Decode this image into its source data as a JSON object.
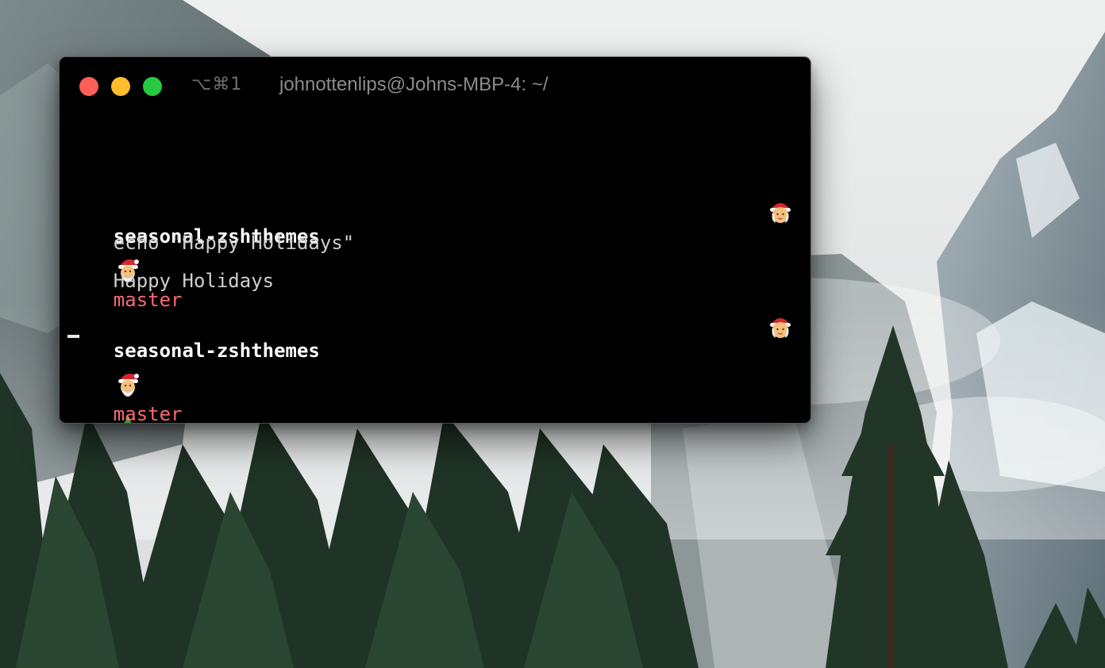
{
  "desktop": {
    "wallpaper": "yosemite-mountains-pine-trees"
  },
  "terminal": {
    "window_title": "johnottenlips@Johns-MBP-4: ~/",
    "tab_shortcut": "⌥⌘1",
    "colors": {
      "background": "#000000",
      "directory": "#ffffff",
      "branch": "#f7696d",
      "output": "#cfcfcf",
      "traffic_close": "#fe5f57",
      "traffic_minimize": "#febc2e",
      "traffic_zoom": "#28c840"
    },
    "lines": [
      {
        "type": "prompt",
        "left_icon": "santa-icon",
        "directory": "seasonal-zshthemes",
        "branch": "master",
        "right_icon": "christmas-tree-icon"
      },
      {
        "type": "command",
        "text": "echo \"Happy Holidays\"",
        "rprompt_icon": "mrs-claus-icon"
      },
      {
        "type": "output",
        "text": "Happy Holidays"
      },
      {
        "type": "prompt",
        "left_icon": "santa-icon",
        "directory": "seasonal-zshthemes",
        "branch": "master",
        "right_icon": "christmas-tree-icon"
      },
      {
        "type": "input",
        "text": "",
        "rprompt_icon": "mrs-claus-icon"
      }
    ]
  }
}
